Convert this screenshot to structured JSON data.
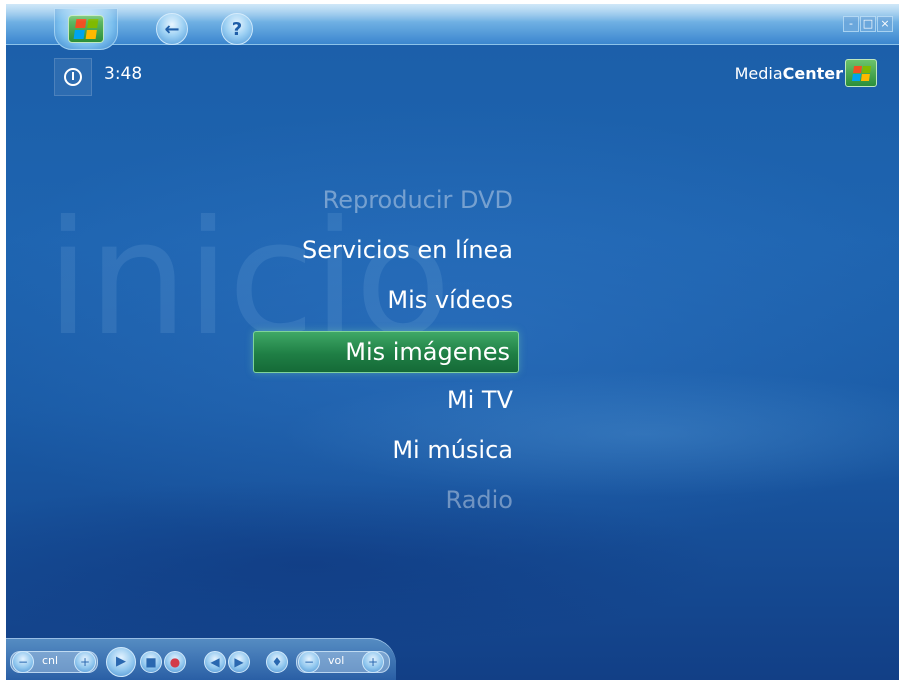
{
  "topbar": {
    "back_icon": "arrow-left-icon",
    "help_label": "?",
    "window_controls": [
      "-",
      "□",
      "×"
    ]
  },
  "status": {
    "clock": "3:48"
  },
  "brand": {
    "name_light": "Media",
    "name_bold": "Center"
  },
  "watermark": "inicio",
  "menu": {
    "items": [
      "Reproducir DVD",
      "Servicios en línea",
      "Mis vídeos",
      "Mis imágenes",
      "Mi TV",
      "Mi música",
      "Radio"
    ],
    "focused": "Mis imágenes"
  },
  "transport": {
    "channel_label": "cnl",
    "volume_label": "vol",
    "icons": [
      "minus-icon",
      "plus-icon",
      "play-icon",
      "stop-icon",
      "record-icon",
      "rewind-icon",
      "fast-forward-icon",
      "mute-icon",
      "minus-icon",
      "plus-icon"
    ]
  },
  "colors": {
    "background": "#1e64b0",
    "focus": "#1f7f45",
    "text": "#ffffff"
  }
}
